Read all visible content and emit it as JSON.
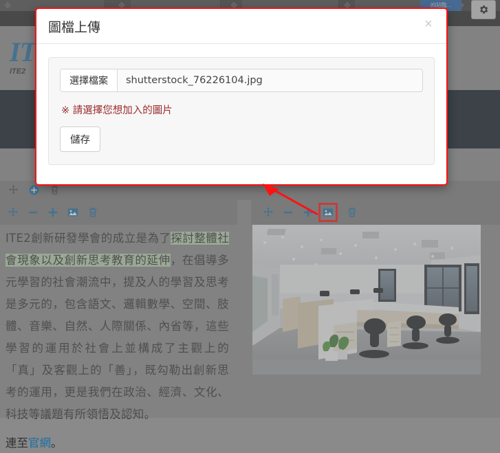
{
  "browser": {
    "active_tab_label": "(6)站臨…",
    "gear_icon": "gear-icon"
  },
  "site": {
    "logo_main": "ITE2",
    "logo_sub": "ITE2"
  },
  "modal": {
    "title": "圖檔上傳",
    "close_label": "×",
    "file_button_label": "選擇檔案",
    "file_name": "shutterstock_76226104.jpg",
    "hint": "※ 請選擇您想加入的圖片",
    "save_label": "儲存"
  },
  "section_toolbar": {
    "items": [
      {
        "name": "move-icon",
        "label": "移動"
      },
      {
        "name": "add-circle-icon",
        "label": "新增"
      },
      {
        "name": "trash-icon",
        "label": "刪除"
      }
    ]
  },
  "left_column": {
    "toolbar": [
      {
        "name": "move-icon",
        "label": "移動"
      },
      {
        "name": "minus-icon",
        "label": "縮小"
      },
      {
        "name": "plus-icon",
        "label": "放大"
      },
      {
        "name": "image-icon",
        "label": "圖片"
      },
      {
        "name": "trash-icon",
        "label": "刪除"
      }
    ],
    "paragraph_before": "ITE2創新研發學會的成立是為了",
    "paragraph_highlight": "探討整體社會現象以及創新思考教育的延伸",
    "paragraph_after": "，在倡導多元學習的社會潮流中，提及人的學習及思考是多元的，包含語文、邏輯數學、空間、肢體、音樂、自然、人際關係、內省等，這些學習的運用於社會上並構成了主觀上的「真」及客觀上的「善」，既勾勒出創新思考的運用，更是我們在政治、經濟、文化、科技等議題有所領悟及認知。",
    "link_prefix": "連至",
    "link_text": "官網",
    "link_suffix": "。"
  },
  "right_column": {
    "toolbar": [
      {
        "name": "move-icon",
        "label": "移動"
      },
      {
        "name": "minus-icon",
        "label": "縮小"
      },
      {
        "name": "plus-icon",
        "label": "放大"
      },
      {
        "name": "image-icon",
        "label": "圖片",
        "highlighted": true
      },
      {
        "name": "trash-icon",
        "label": "刪除"
      }
    ],
    "photo_alt": "辦公室室內照片"
  },
  "colors": {
    "accent_blue": "#1c6ea4",
    "annotation_red": "#ff1111",
    "highlight_green": "#b7d0ae",
    "hint_red": "#9b2d2d",
    "page_gray": "#8a8a8a",
    "hero_navy": "#0c1622"
  }
}
